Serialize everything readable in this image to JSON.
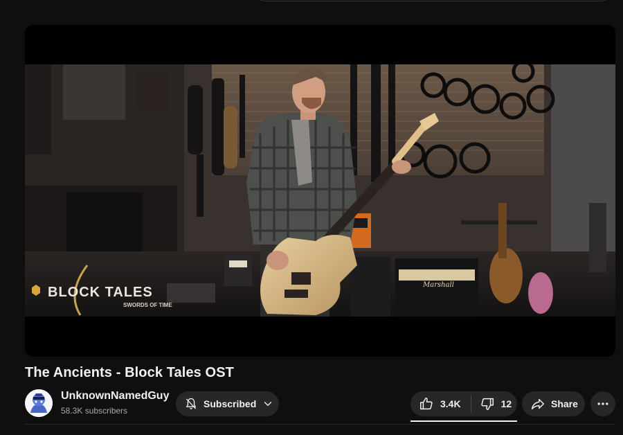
{
  "video": {
    "title": "The Ancients - Block Tales OST",
    "overlay_logo": {
      "main": "BLOCK TALES",
      "sub": "SWORDS OF TIME",
      "amp_brand": "Marshall"
    }
  },
  "channel": {
    "name": "UnknownNamedGuy",
    "subscribers": "58.3K subscribers",
    "avatar_icon": "cartoon-avatar-icon"
  },
  "actions": {
    "subscribed_label": "Subscribed",
    "likes": "3.4K",
    "dislikes": "12",
    "share_label": "Share"
  },
  "icons": {
    "bell": "bell-slash-icon",
    "chevron": "chevron-down-icon",
    "like": "thumbs-up-icon",
    "dislike": "thumbs-down-icon",
    "share": "share-arrow-icon",
    "more": "more-horizontal-icon"
  },
  "colors": {
    "background": "#0f0f0f",
    "pill": "#272727",
    "text": "#f1f1f1",
    "secondary_text": "#aaaaaa",
    "logo_gold": "#c9a44a"
  }
}
